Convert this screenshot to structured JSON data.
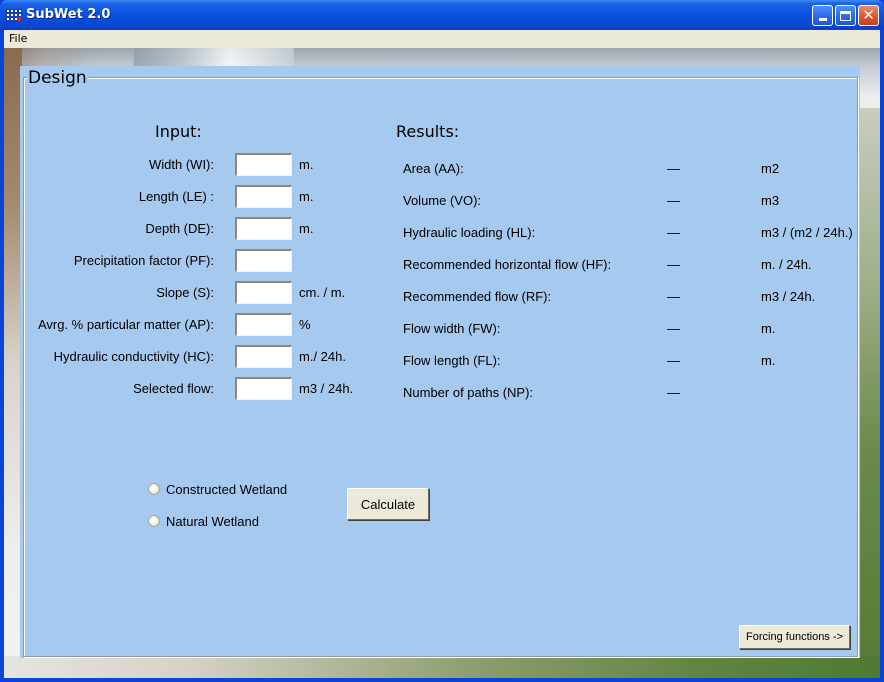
{
  "window": {
    "title": "SubWet 2.0",
    "app_icon": "subwet-app-icon",
    "controls": {
      "minimize": "minimize-icon",
      "maximize": "maximize-icon",
      "close": "close-icon"
    }
  },
  "menubar": {
    "items": [
      {
        "label": "File"
      }
    ]
  },
  "design": {
    "group_title": "Design",
    "input_heading": "Input:",
    "results_heading": "Results:",
    "inputs": [
      {
        "label": "Width (WI):",
        "value": "",
        "unit": "m."
      },
      {
        "label": "Length (LE) :",
        "value": "",
        "unit": "m."
      },
      {
        "label": "Depth (DE):",
        "value": "",
        "unit": "m."
      },
      {
        "label": "Precipitation factor (PF):",
        "value": "",
        "unit": ""
      },
      {
        "label": "Slope (S):",
        "value": "",
        "unit": "cm. / m."
      },
      {
        "label": "Avrg. % particular matter (AP):",
        "value": "",
        "unit": "%"
      },
      {
        "label": "Hydraulic conductivity (HC):",
        "value": "",
        "unit": "m./ 24h."
      },
      {
        "label": "Selected flow:",
        "value": "",
        "unit": "m3 / 24h."
      }
    ],
    "results": [
      {
        "label": "Area (AA):",
        "value": "—",
        "unit": "m2"
      },
      {
        "label": "Volume (VO):",
        "value": "—",
        "unit": "m3"
      },
      {
        "label": "Hydraulic loading (HL):",
        "value": "—",
        "unit": "m3 / (m2 / 24h.)"
      },
      {
        "label": "Recommended horizontal flow (HF):",
        "value": "—",
        "unit": "m. / 24h."
      },
      {
        "label": "Recommended flow (RF):",
        "value": "—",
        "unit": "m3 / 24h."
      },
      {
        "label": "Flow width (FW):",
        "value": "—",
        "unit": "m."
      },
      {
        "label": "Flow length (FL):",
        "value": "—",
        "unit": "m."
      },
      {
        "label": "Number of paths (NP):",
        "value": "—",
        "unit": ""
      }
    ],
    "wetland_type": {
      "options": [
        {
          "label": "Constructed Wetland",
          "selected": false
        },
        {
          "label": "Natural Wetland",
          "selected": false
        }
      ]
    },
    "calculate_label": "Calculate",
    "forcing_label": "Forcing functions ->"
  }
}
